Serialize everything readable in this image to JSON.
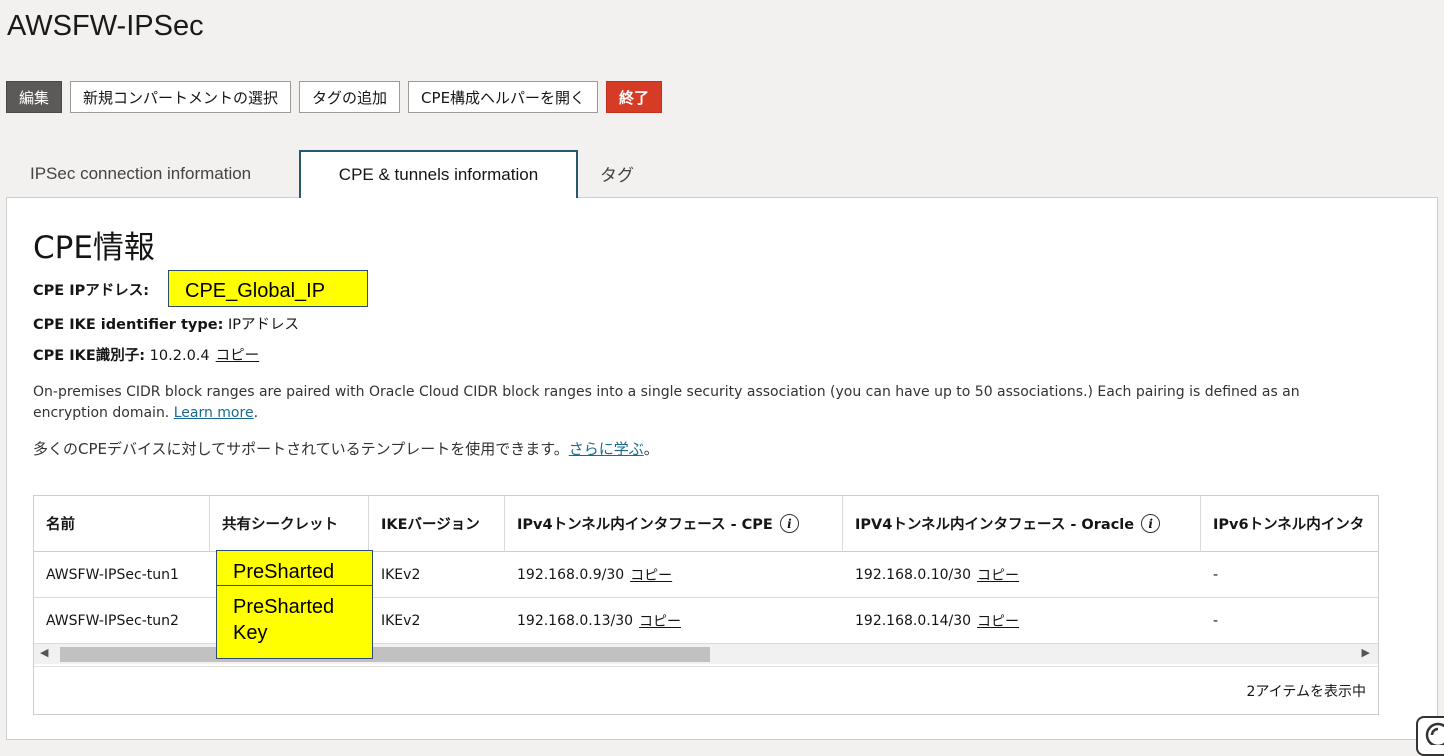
{
  "page": {
    "title": "AWSFW-IPSec"
  },
  "toolbar": {
    "edit": "編集",
    "move_compartment": "新規コンパートメントの選択",
    "add_tags": "タグの追加",
    "cpe_helper": "CPE構成ヘルパーを開く",
    "terminate": "終了"
  },
  "tabs": [
    "IPSec connection information",
    "CPE & tunnels information",
    "タグ"
  ],
  "cpe": {
    "heading": "CPE情報",
    "ip_label": "CPE IPアドレス:",
    "ip_value": "CPE_Global_IP",
    "ike_type_label": "CPE IKE identifier type:",
    "ike_type_value": "IPアドレス",
    "ike_id_label": "CPE IKE識別子:",
    "ike_id_value": "10.2.0.4",
    "copy": "コピー",
    "desc_line1": "On-premises CIDR block ranges are paired with Oracle Cloud CIDR block ranges into a single security association (you can have up to 50 associations.) Each pairing is defined as an",
    "desc_line2": "encryption domain.",
    "learn_more": "Learn more",
    "period": ".",
    "template_text": "多くのCPEデバイスに対してサポートされているテンプレートを使用できます。",
    "template_link": "さらに学ぶ",
    "template_end": "。"
  },
  "table": {
    "columns": [
      "名前",
      "共有シークレット",
      "IKEバージョン",
      "IPv4トンネル内インタフェース - CPE",
      "IPV4トンネル内インタフェース - Oracle",
      "IPv6トンネル内インタ"
    ],
    "rows": [
      {
        "name": "AWSFW-IPSec-tun1",
        "ike": "IKEv2",
        "cpe_if": "192.168.0.9/30",
        "oracle_if": "192.168.0.10/30",
        "ipv6": "-"
      },
      {
        "name": "AWSFW-IPSec-tun2",
        "ike": "IKEv2",
        "cpe_if": "192.168.0.13/30",
        "oracle_if": "192.168.0.14/30",
        "ipv6": "-"
      }
    ],
    "copy": "コピー",
    "info_glyph": "i",
    "footer": "2アイテムを表示中"
  },
  "callouts": {
    "secret1": "PreSharted",
    "secret2": "PreSharted Key"
  }
}
